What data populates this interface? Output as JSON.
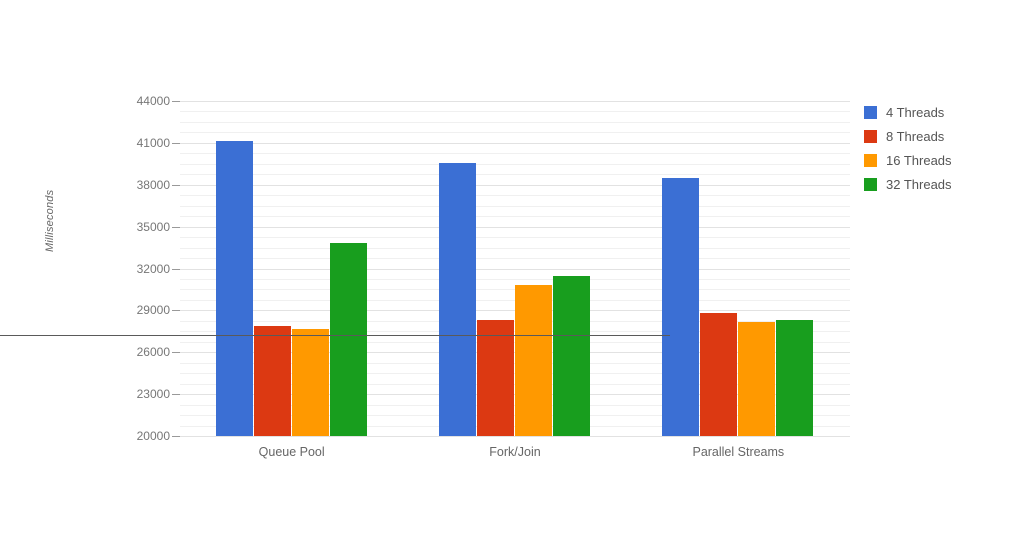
{
  "chart_data": {
    "type": "bar",
    "title": "",
    "subtitle": "",
    "xlabel": "",
    "ylabel": "Milliseconds",
    "categories": [
      "Queue Pool",
      "Fork/Join",
      "Parallel Streams"
    ],
    "series": [
      {
        "name": "4 Threads",
        "color": "#3B6FD4",
        "values": [
          41100,
          39550,
          38450
        ]
      },
      {
        "name": "8 Threads",
        "color": "#DC3912",
        "values": [
          27850,
          28300,
          28800
        ]
      },
      {
        "name": "16 Threads",
        "color": "#FF9900",
        "values": [
          27700,
          30800,
          28150
        ]
      },
      {
        "name": "32 Threads",
        "color": "#189E1E",
        "values": [
          33800,
          31450,
          28300
        ]
      }
    ],
    "ylim": [
      20000,
      44000
    ],
    "y_ticks": [
      20000,
      23000,
      26000,
      29000,
      32000,
      35000,
      38000,
      41000,
      44000
    ],
    "y_tick_labels": [
      "20000",
      "23000",
      "26000",
      "29000",
      "32000",
      "35000",
      "38000",
      "41000",
      "44000"
    ],
    "minor_gridlines_per_major": 4,
    "grid": true,
    "legend_position": "right",
    "background_color": "#FFFFFF",
    "gridline_color": "#F0F0F0",
    "axis_color": "#5A5A5A",
    "label_color": "#777777"
  },
  "legend": {
    "items": [
      {
        "label": "4 Threads",
        "color": "#3B6FD4"
      },
      {
        "label": "8 Threads",
        "color": "#DC3912"
      },
      {
        "label": "16 Threads",
        "color": "#FF9900"
      },
      {
        "label": "32 Threads",
        "color": "#189E1E"
      }
    ]
  }
}
